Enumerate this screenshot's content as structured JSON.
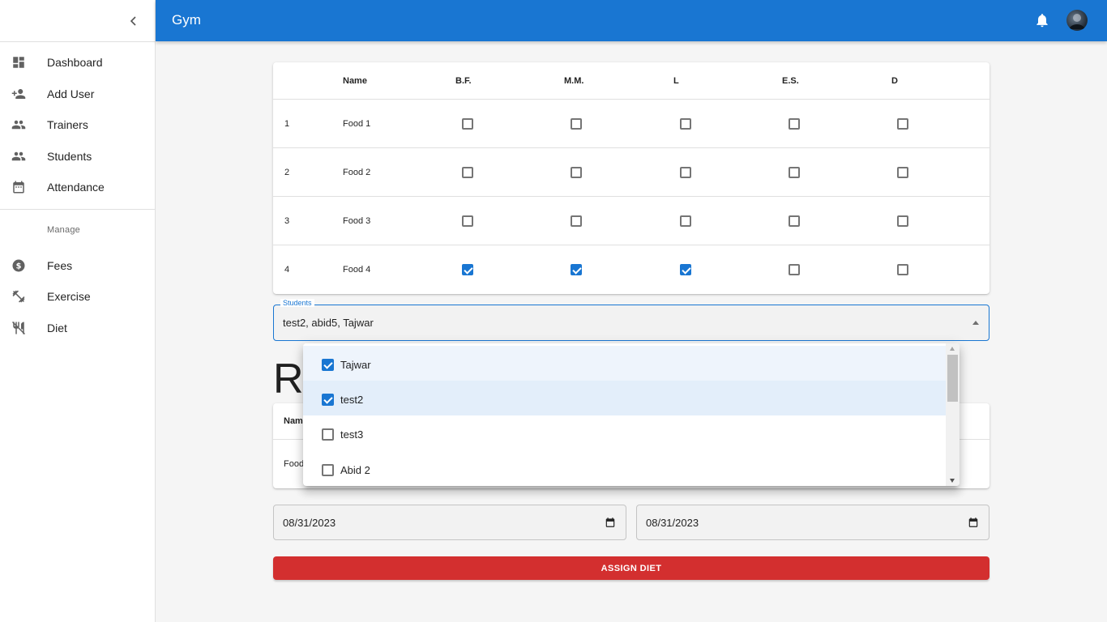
{
  "app": {
    "title": "Gym"
  },
  "sidebar": {
    "items": [
      {
        "label": "Dashboard",
        "icon": "dashboard-icon"
      },
      {
        "label": "Add User",
        "icon": "person-add-icon"
      },
      {
        "label": "Trainers",
        "icon": "people-icon"
      },
      {
        "label": "Students",
        "icon": "people-icon"
      },
      {
        "label": "Attendance",
        "icon": "calendar-icon"
      }
    ],
    "section_label": "Manage",
    "manage_items": [
      {
        "label": "Fees",
        "icon": "dollar-icon"
      },
      {
        "label": "Exercise",
        "icon": "fitness-icon"
      },
      {
        "label": "Diet",
        "icon": "restaurant-icon"
      }
    ]
  },
  "food_table": {
    "columns": [
      "",
      "Name",
      "B.F.",
      "M.M.",
      "L",
      "E.S.",
      "D"
    ],
    "rows": [
      {
        "index": "1",
        "name": "Food 1",
        "checks": [
          false,
          false,
          false,
          false,
          false
        ]
      },
      {
        "index": "2",
        "name": "Food 2",
        "checks": [
          false,
          false,
          false,
          false,
          false
        ]
      },
      {
        "index": "3",
        "name": "Food 3",
        "checks": [
          false,
          false,
          false,
          false,
          false
        ]
      },
      {
        "index": "4",
        "name": "Food 4",
        "checks": [
          true,
          true,
          true,
          false,
          false
        ]
      }
    ]
  },
  "students_select": {
    "label": "Students",
    "value": "test2, abid5, Tajwar",
    "options": [
      {
        "label": "Tajwar",
        "checked": true
      },
      {
        "label": "test2",
        "checked": true
      },
      {
        "label": "test3",
        "checked": false
      },
      {
        "label": "Abid 2",
        "checked": false
      }
    ]
  },
  "background_section": {
    "heading_partial": "R",
    "header_partial": "Nam",
    "row_partial": "Food"
  },
  "dates": {
    "start": "08/31/2023",
    "end": "08/31/2023"
  },
  "assign_button": "ASSIGN DIET",
  "colors": {
    "primary": "#1976d2",
    "danger": "#d32f2f"
  }
}
